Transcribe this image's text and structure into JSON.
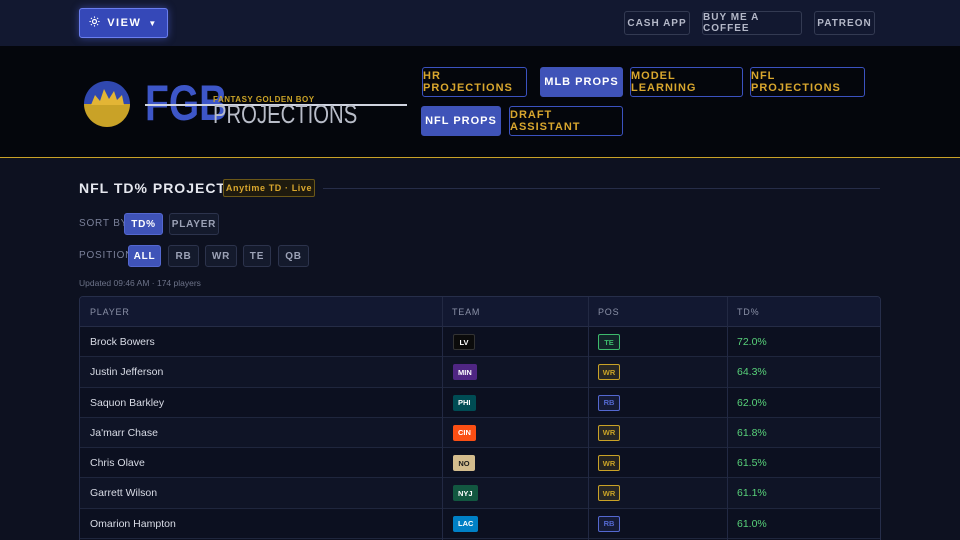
{
  "topbar": {
    "view_label": "VIEW",
    "links": [
      "CASH APP",
      "BUY ME A COFFEE",
      "PATREON"
    ]
  },
  "logo": {
    "fgb": "FGB",
    "tagline": "FANTASY GOLDEN BOY",
    "projections": "PROJECTIONS"
  },
  "nav": {
    "hr_projections": "HR PROJECTIONS",
    "mlb_props": "MLB PROPS",
    "model_learning": "MODEL LEARNING",
    "nfl_projections": "NFL PROJECTIONS",
    "nfl_props": "NFL PROPS",
    "draft_assistant": "DRAFT ASSISTANT"
  },
  "section": {
    "title": "NFL TD% PROJECTIONS",
    "badge": "Anytime TD · Live"
  },
  "sort": {
    "label": "SORT BY:",
    "options": [
      "TD%",
      "PLAYER"
    ],
    "selected": "TD%"
  },
  "position": {
    "label": "POSITION:",
    "options": [
      "ALL",
      "RB",
      "WR",
      "TE",
      "QB"
    ],
    "selected": "ALL"
  },
  "updated": "Updated 09:46 AM · 174 players",
  "table": {
    "headers": [
      "PLAYER",
      "TEAM",
      "POS",
      "TD%"
    ],
    "rows": [
      {
        "player": "Brock Bowers",
        "team": "LV",
        "pos": "TE",
        "td": "72.0%"
      },
      {
        "player": "Justin Jefferson",
        "team": "MIN",
        "pos": "WR",
        "td": "64.3%"
      },
      {
        "player": "Saquon Barkley",
        "team": "PHI",
        "pos": "RB",
        "td": "62.0%"
      },
      {
        "player": "Ja'marr Chase",
        "team": "CIN",
        "pos": "WR",
        "td": "61.8%"
      },
      {
        "player": "Chris Olave",
        "team": "NO",
        "pos": "WR",
        "td": "61.5%"
      },
      {
        "player": "Garrett Wilson",
        "team": "NYJ",
        "pos": "WR",
        "td": "61.1%"
      },
      {
        "player": "Omarion Hampton",
        "team": "LAC",
        "pos": "RB",
        "td": "61.0%"
      }
    ]
  },
  "colors": {
    "accent": "#3f53b8",
    "gold": "#d9a72e",
    "positive": "#58d27a",
    "team": {
      "LV": "#0b0b0b",
      "MIN": "#4f2683",
      "PHI": "#004c54",
      "CIN": "#fb4f14",
      "NO": "#d3bc8d",
      "NYJ": "#125740",
      "LAC": "#0080c6"
    },
    "pos": {
      "TE": "#3dbb6c",
      "WR": "#c9a227",
      "RB": "#5468d0"
    }
  }
}
